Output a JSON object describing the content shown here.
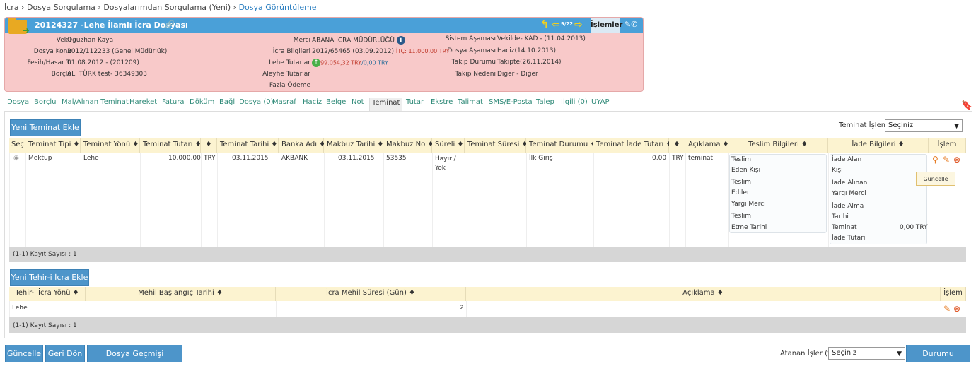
{
  "breadcrumb": [
    "İcra",
    "Dosya Sorgulama",
    "Dosyalarımdan Sorgulama (Yeni)",
    "Dosya Görüntüleme"
  ],
  "case": {
    "title": "20124327 -Lehe İlamlı İcra Dosyası",
    "pager": "9/22",
    "islem_label": "İşlemler",
    "fields": {
      "vekil_label": "Vekil",
      "vekil": "Oğuzhan Kaya",
      "konu_label": "Dosya Konu",
      "konu": "2012/112233 (Genel Müdürlük)",
      "fesih_label": "Fesih/Hasar T.",
      "fesih": "01.08.2012 - (201209)",
      "borclu_label": "Borçlu",
      "borclu": "ALİ TÜRK test- 36349303",
      "merci_label": "Merci",
      "merci": "ABANA İCRA MÜDÜRLÜĞÜ",
      "icra_label": "İcra Bilgileri",
      "icra": "2012/65465 (03.09.2012)",
      "itc": "İTÇ: 11.000,00 TRY",
      "lehe_label": "Lehe Tutarlar",
      "lehe1": "99.054,32 TRY",
      "lehe2": "/0,00 TRY",
      "aleyhe_label": "Aleyhe Tutarlar",
      "fazla_label": "Fazla Ödeme",
      "sistem_label": "Sistem Aşaması",
      "sistem": "Vekilde- KAD - (11.04.2013)",
      "asama_label": "Dosya Aşaması",
      "asama": "Haciz(14.10.2013)",
      "takip_label": "Takip Durumu",
      "takip": "Takipte(26.11.2014)",
      "neden_label": "Takip Nedeni",
      "neden": "Diğer - Diğer"
    }
  },
  "tabs": [
    "Dosya",
    "Borçlu",
    "Mal/Alınan Teminat",
    "Hareket",
    "Fatura",
    "Döküm",
    "Bağlı Dosya (0)",
    "Masraf",
    "Haciz",
    "Belge",
    "Not",
    "Teminat",
    "Tutar",
    "Ekstre",
    "Talimat",
    "SMS/E-Posta",
    "Talep",
    "İlgili (0)",
    "UYAP"
  ],
  "active_tab": "Teminat",
  "teminat": {
    "add_button": "Yeni Teminat Ekle",
    "islem_label": "Teminat İşlem",
    "islem_value": "Seçiniz",
    "headers": [
      "Seç",
      "Teminat Tipi ♦",
      "Teminat Yönü ♦",
      "Teminat Tutarı ♦",
      "♦",
      "Teminat Tarihi ♦",
      "Banka Adı ♦",
      "Makbuz Tarihi ♦",
      "Makbuz No ♦",
      "Süreli ♦",
      "Teminat Süresi ♦",
      "Teminat Durumu ♦",
      "Teminat İade Tutarı ♦",
      "♦",
      "Açıklama ♦",
      "Teslim Bilgileri ♦",
      "İade Bilgileri ♦",
      "İşlem"
    ],
    "row": {
      "tip": "Mektup",
      "yon": "Lehe",
      "tutar": "10.000,00",
      "cur": "TRY",
      "tarih": "03.11.2015",
      "banka": "AKBANK",
      "mtarih": "03.11.2015",
      "mno": "53535",
      "sureli": "Hayır / Yok",
      "durum": "İlk Giriş",
      "iade": "0,00",
      "cur2": "TRY",
      "aciklama": "teminat"
    },
    "teslim": [
      "Teslim",
      "Eden Kişi",
      "Teslim",
      "Edilen",
      "Yargı Merci",
      "Teslim",
      "Etme Tarihi"
    ],
    "iade_info": [
      "İade Alan",
      "Kişi",
      "İade Alınan",
      "Yargı Merci",
      "İade Alma",
      "Tarihi",
      "Teminat",
      "İade Tutarı"
    ],
    "iade_amount": "0,00 TRY",
    "tooltip": "Güncelle",
    "count": "(1-1) Kayıt Sayısı : 1"
  },
  "tehir": {
    "add_button": "Yeni Tehir-i İcra Ekle",
    "headers": [
      "Tehir-i İcra Yönü ♦",
      "Mehil Başlangıç Tarihi ♦",
      "İcra Mehil Süresi (Gün) ♦",
      "Açıklama ♦",
      "İşlem"
    ],
    "row": {
      "yon": "Lehe",
      "sure": "2"
    },
    "count": "(1-1) Kayıt Sayısı : 1"
  },
  "footer": {
    "guncelle": "Güncelle",
    "geri": "Geri Dön",
    "gecmis": "Dosya Geçmişi Görüntüle",
    "atanan_label": "Atanan İşler (*)",
    "atanan_value": "Seçiniz",
    "durum": "Durumu Değiştir"
  },
  "colors": {
    "accent": "#4aa0d8",
    "case_bg": "#f8c9c9",
    "header_bg": "#fcf3d0"
  }
}
